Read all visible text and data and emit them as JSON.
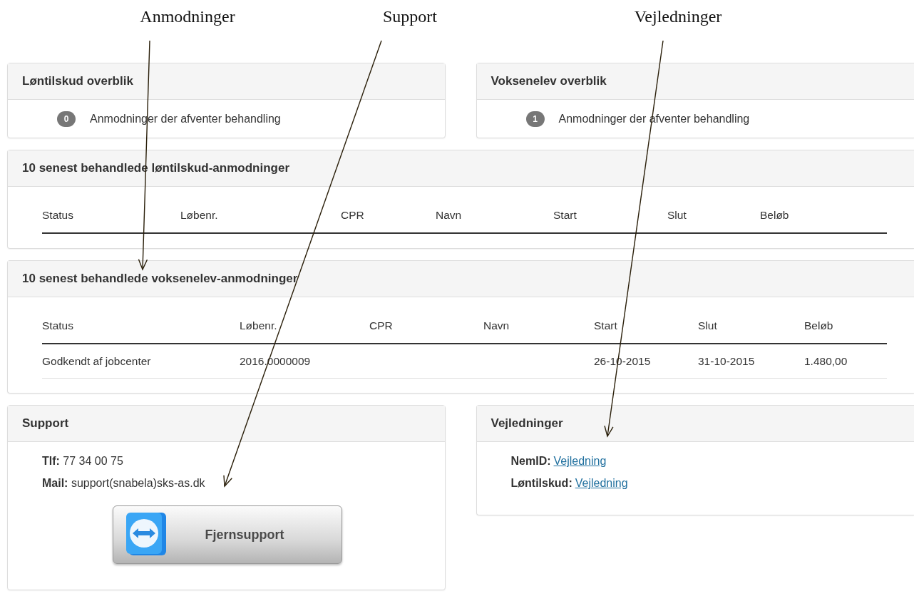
{
  "annotations": [
    {
      "label": "Anmodninger"
    },
    {
      "label": "Support"
    },
    {
      "label": "Vejledninger"
    }
  ],
  "overview_panels": [
    {
      "title": "Løntilskud overblik",
      "badge": "0",
      "text": "Anmodninger der afventer behandling"
    },
    {
      "title": "Voksenelev overblik",
      "badge": "1",
      "text": "Anmodninger der afventer behandling"
    }
  ],
  "tables": [
    {
      "title": "10 senest behandlede løntilskud-anmodninger",
      "columns": [
        "Status",
        "Løbenr.",
        "CPR",
        "Navn",
        "Start",
        "Slut",
        "Beløb"
      ]
    },
    {
      "title": "10 senest behandlede voksenelev-anmodninger",
      "columns": [
        "Status",
        "Løbenr.",
        "CPR",
        "Navn",
        "Start",
        "Slut",
        "Beløb"
      ],
      "rows": [
        [
          "Godkendt af jobcenter",
          "2016.0000009",
          "",
          "",
          "26-10-2015",
          "31-10-2015",
          "1.480,00"
        ]
      ]
    }
  ],
  "support": {
    "title": "Support",
    "lines": [
      {
        "label": "Tlf:",
        "value": "77 34 00 75"
      },
      {
        "label": "Mail:",
        "value": "support(snabela)sks-as.dk"
      }
    ],
    "button": "Fjernsupport"
  },
  "guides": {
    "title": "Vejledninger",
    "links": [
      {
        "label": "NemID:",
        "link": "Vejledning"
      },
      {
        "label": "Løntilskud:",
        "link": "Vejledning"
      }
    ]
  }
}
